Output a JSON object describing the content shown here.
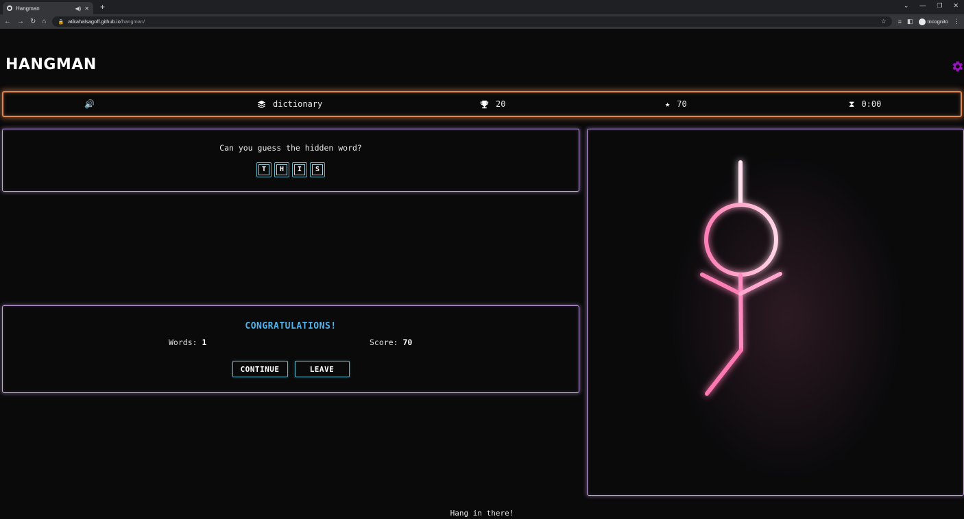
{
  "browser": {
    "tab_title": "Hangman",
    "url_host": "atikahalsagoff.github.io",
    "url_path": "/hangman/",
    "incognito_label": "Incognito"
  },
  "header": {
    "title": "HANGMAN",
    "settings_icon": "gear-icon",
    "accent_color": "#a012c8"
  },
  "stats": {
    "sound_icon": "volume-icon",
    "category_icon": "layers-icon",
    "category": "dictionary",
    "trophy_icon": "trophy-icon",
    "trophies": "20",
    "star_icon": "star-icon",
    "points": "70",
    "timer_icon": "hourglass-icon",
    "time": "0:00"
  },
  "guess": {
    "prompt": "Can you guess the hidden word?",
    "letters": [
      "T",
      "H",
      "I",
      "S"
    ]
  },
  "result": {
    "heading": "CONGRATULATIONS!",
    "words_label": "Words:",
    "words_value": "1",
    "score_label": "Score:",
    "score_value": "70",
    "continue_label": "CONTINUE",
    "leave_label": "LEAVE"
  },
  "footer": {
    "message": "Hang in there!"
  },
  "colors": {
    "stat_border": "#e0874f",
    "panel_border": "#c4a3e0",
    "tile_border": "#5fb8c8",
    "congrats": "#4fb4ee",
    "figure_pink": "#ff79b4"
  }
}
